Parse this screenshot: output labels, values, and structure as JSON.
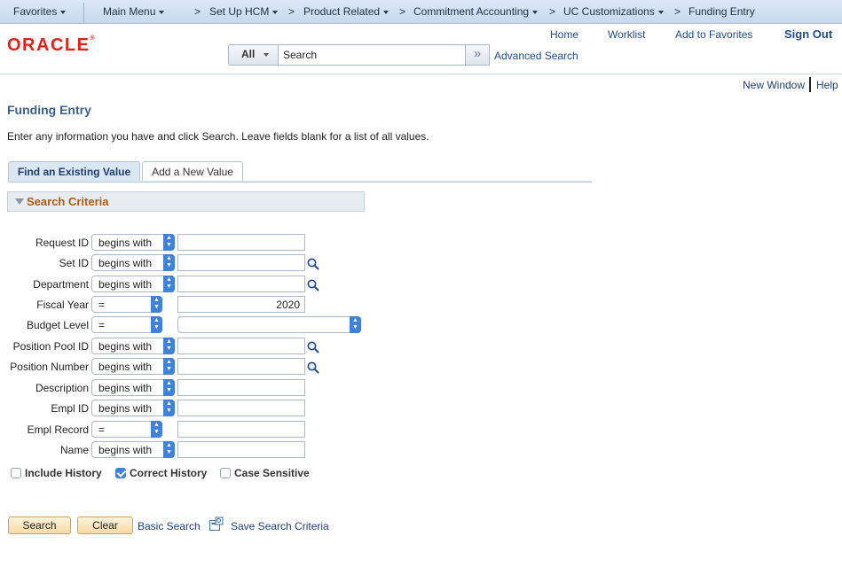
{
  "navbar": {
    "favorites": "Favorites",
    "main_menu": "Main Menu",
    "breadcrumbs": [
      {
        "label": "Set Up HCM",
        "has_menu": true
      },
      {
        "label": "Product Related",
        "has_menu": true
      },
      {
        "label": "Commitment Accounting",
        "has_menu": true
      },
      {
        "label": "UC Customizations",
        "has_menu": true
      },
      {
        "label": "Funding Entry",
        "has_menu": false
      }
    ]
  },
  "header": {
    "logo": "ORACLE",
    "links": {
      "home": "Home",
      "worklist": "Worklist",
      "add_to_favorites": "Add to Favorites",
      "sign_out": "Sign Out"
    },
    "search": {
      "scope": "All",
      "value": "Search",
      "go": "»",
      "advanced": "Advanced Search"
    }
  },
  "utility": {
    "new_window": "New Window",
    "help": "Help"
  },
  "page": {
    "title": "Funding Entry",
    "instructions": "Enter any information you have and click Search. Leave fields blank for a list of all values.",
    "tabs": {
      "find": "Find an Existing Value",
      "add": "Add a New Value"
    },
    "criteria_header": "Search Criteria"
  },
  "criteria": [
    {
      "label": "Request ID",
      "operator": "begins with",
      "value": "",
      "lookup": false
    },
    {
      "label": "Set ID",
      "operator": "begins with",
      "value": "",
      "lookup": true
    },
    {
      "label": "Department",
      "operator": "begins with",
      "value": "",
      "lookup": true
    },
    {
      "label": "Fiscal Year",
      "operator": "=",
      "value": "2020",
      "lookup": false
    },
    {
      "label": "Budget Level",
      "operator": "=",
      "value": "",
      "lookup": false
    },
    {
      "label": "Position Pool ID",
      "operator": "begins with",
      "value": "",
      "lookup": true
    },
    {
      "label": "Position Number",
      "operator": "begins with",
      "value": "",
      "lookup": true
    },
    {
      "label": "Description",
      "operator": "begins with",
      "value": "",
      "lookup": false
    },
    {
      "label": "Empl ID",
      "operator": "begins with",
      "value": "",
      "lookup": false
    },
    {
      "label": "Empl Record",
      "operator": "=",
      "value": "",
      "lookup": false
    },
    {
      "label": "Name",
      "operator": "begins with",
      "value": "",
      "lookup": false
    }
  ],
  "options": {
    "include_history": {
      "label": "Include History",
      "checked": false
    },
    "correct_history": {
      "label": "Correct History",
      "checked": true
    },
    "case_sensitive": {
      "label": "Case Sensitive",
      "checked": false
    }
  },
  "actions": {
    "search": "Search",
    "clear": "Clear",
    "basic_search": "Basic Search",
    "save_criteria": "Save Search Criteria"
  },
  "colors": {
    "accent_blue": "#3f82d8",
    "title_blue": "#3e5f8a",
    "criteria_orange": "#b15a12",
    "oracle_red": "#e0221b",
    "button_gold": "#f5dba4"
  }
}
